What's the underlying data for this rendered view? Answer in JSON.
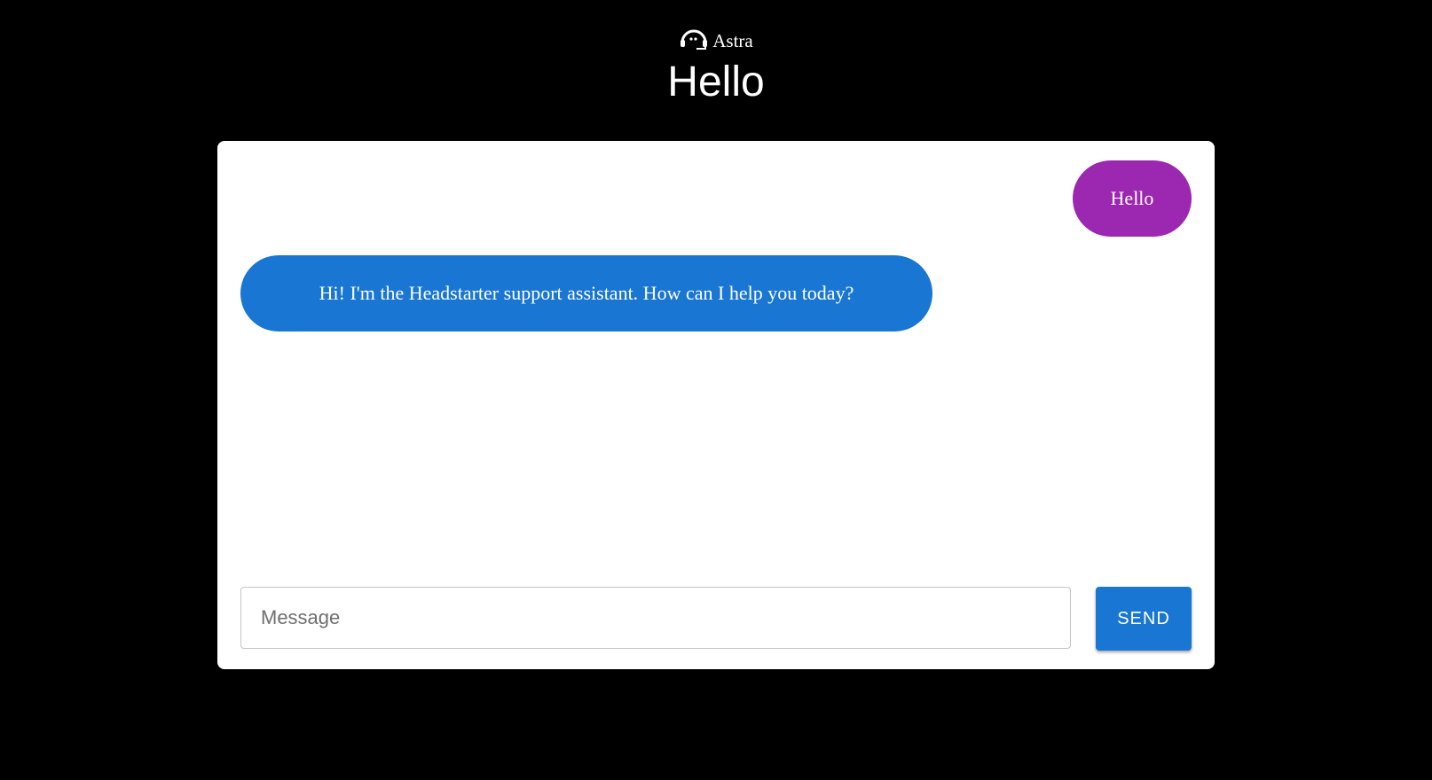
{
  "header": {
    "brand_icon": "headset-icon",
    "brand_name": "Astra",
    "greeting": "Hello"
  },
  "chat": {
    "messages": [
      {
        "role": "user",
        "text": "Hello"
      },
      {
        "role": "assistant",
        "text": "Hi! I'm the Headstarter support assistant. How can I help you today?"
      }
    ]
  },
  "composer": {
    "placeholder": "Message",
    "value": "",
    "send_label": "SEND"
  },
  "colors": {
    "background": "#000000",
    "user_bubble": "#9c27b0",
    "assistant_bubble": "#1976d2",
    "send_button": "#1976d2"
  }
}
